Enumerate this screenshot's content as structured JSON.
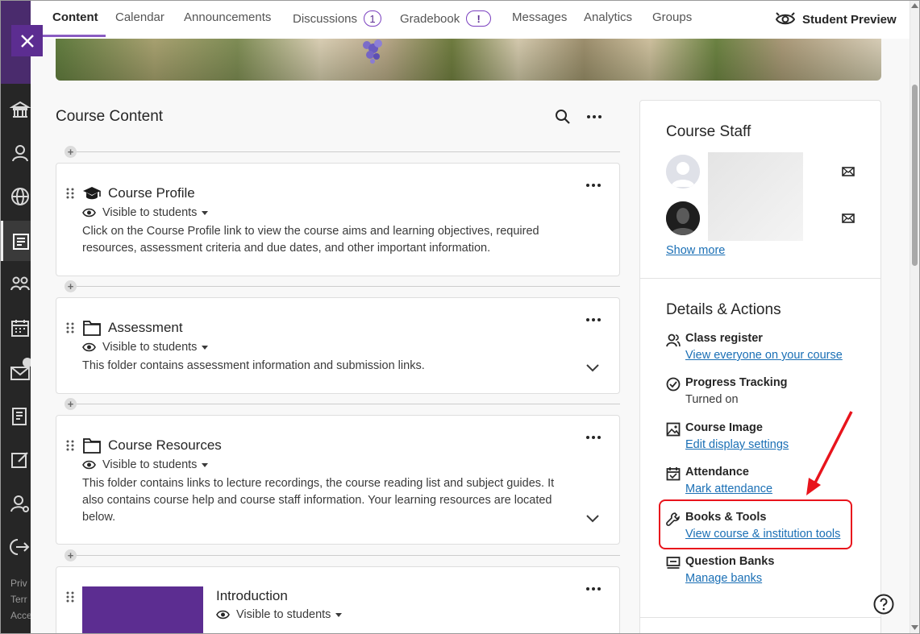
{
  "rail": {
    "footer": [
      "Priv",
      "Terr",
      "Acce"
    ]
  },
  "tabs": [
    {
      "label": "Content",
      "active": true
    },
    {
      "label": "Calendar"
    },
    {
      "label": "Announcements"
    },
    {
      "label": "Discussions",
      "badge": "1"
    },
    {
      "label": "Gradebook",
      "badge": "!"
    },
    {
      "label": "Messages"
    },
    {
      "label": "Analytics"
    },
    {
      "label": "Groups"
    }
  ],
  "student_preview": "Student Preview",
  "course_content": {
    "title": "Course Content",
    "items": [
      {
        "title": "Course Profile",
        "icon": "graduation-cap-icon",
        "visibility": "Visible to students",
        "description": "Click on the Course Profile link to view the course aims and learning objectives, required resources, assessment criteria and due dates, and other important information."
      },
      {
        "title": "Assessment",
        "icon": "folder-icon",
        "visibility": "Visible to students",
        "description": "This folder contains assessment information and submission links."
      },
      {
        "title": "Course Resources",
        "icon": "folder-icon",
        "visibility": "Visible to students",
        "description": "This folder contains links to lecture recordings, the course reading list and subject guides. It also contains course help and course staff information. Your learning resources are located below."
      },
      {
        "title": "Introduction",
        "icon": "image-thumbnail",
        "visibility": "Visible to students"
      }
    ]
  },
  "course_staff": {
    "title": "Course Staff",
    "show_more": "Show more"
  },
  "details": {
    "title": "Details & Actions",
    "actions": [
      {
        "label": "Class register",
        "sub": "View everyone on your course",
        "link": true,
        "icon": "people-icon"
      },
      {
        "label": "Progress Tracking",
        "sub": "Turned on",
        "link": false,
        "icon": "check-circle-icon"
      },
      {
        "label": "Course Image",
        "sub": "Edit display settings",
        "link": true,
        "icon": "image-icon"
      },
      {
        "label": "Attendance",
        "sub": "Mark attendance",
        "link": true,
        "icon": "calendar-check-icon"
      },
      {
        "label": "Books & Tools",
        "sub": "View course & institution tools",
        "link": true,
        "icon": "wrench-icon"
      },
      {
        "label": "Question Banks",
        "sub": "Manage banks",
        "link": true,
        "icon": "question-bank-icon"
      }
    ]
  },
  "colors": {
    "accent": "#5c2d91",
    "link": "#1a6fb5",
    "highlight": "#e8141c"
  }
}
